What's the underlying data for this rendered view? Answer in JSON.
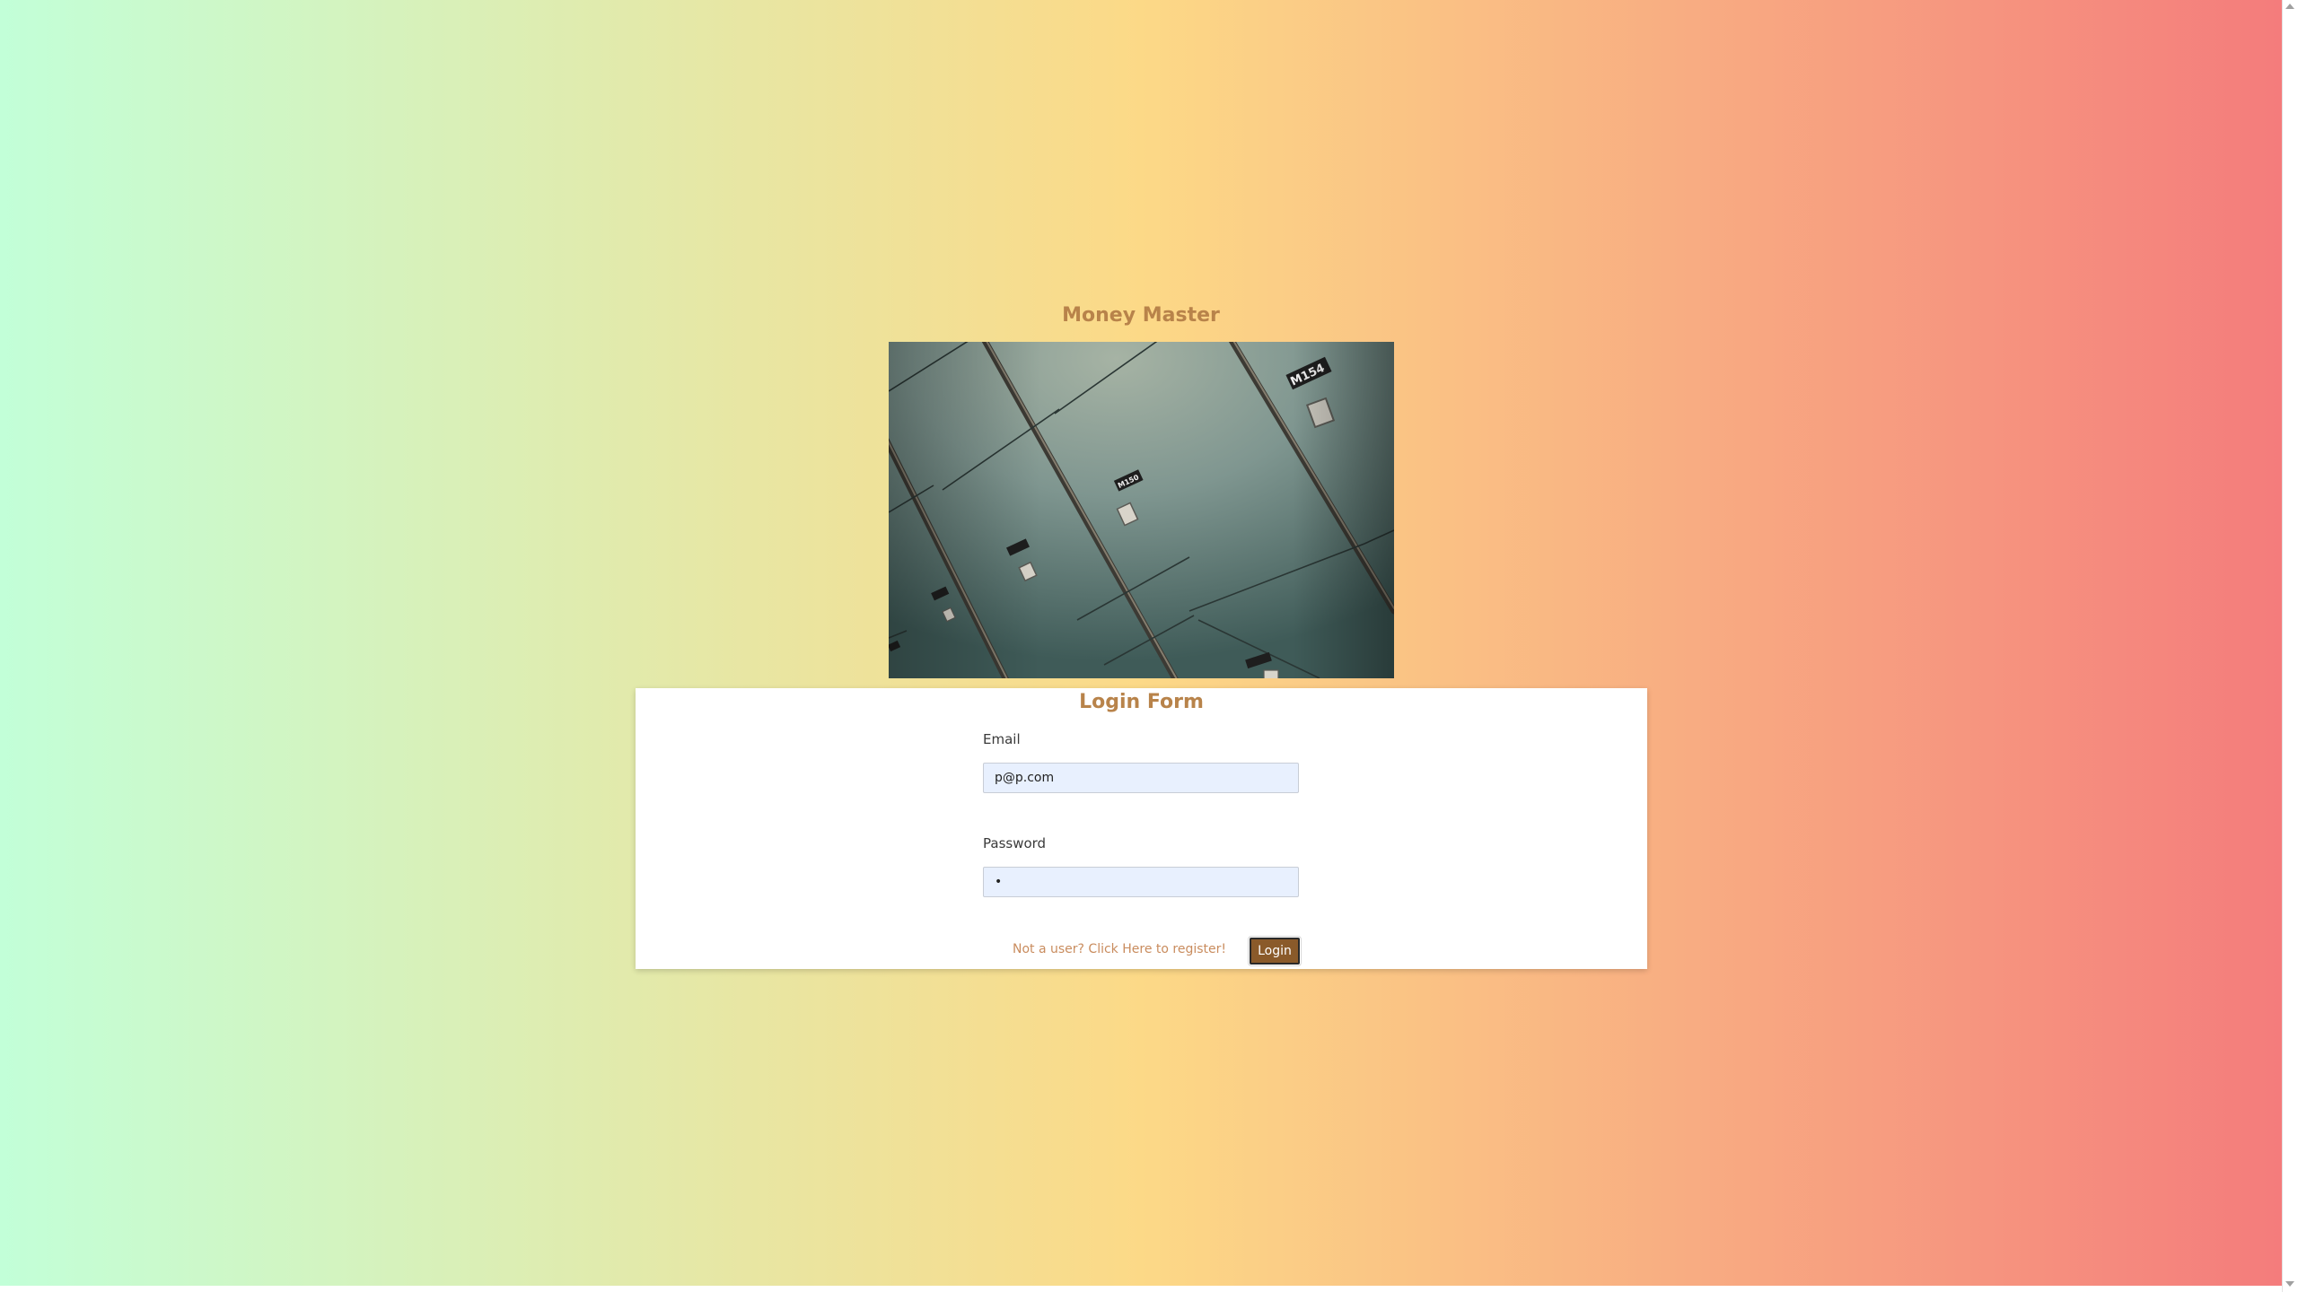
{
  "app": {
    "title": "Money Master"
  },
  "hero_image": {
    "subject": "safe deposit lockers",
    "locker_labels": [
      "M154",
      "M150",
      "M146",
      "M142",
      "M151"
    ]
  },
  "login_form": {
    "title": "Login Form",
    "email": {
      "label": "Email",
      "value": "p@p.com"
    },
    "password": {
      "label": "Password",
      "value": "•"
    },
    "register_link": "Not a user? Click Here to register!",
    "login_button": "Login"
  },
  "colors": {
    "gradient_left": "#c2ffd8",
    "gradient_mid": "#fcd987",
    "gradient_right": "#f47c7c",
    "accent_text": "#b8834a",
    "button_bg": "#8a5a2a",
    "input_bg": "#e8f0fe"
  }
}
